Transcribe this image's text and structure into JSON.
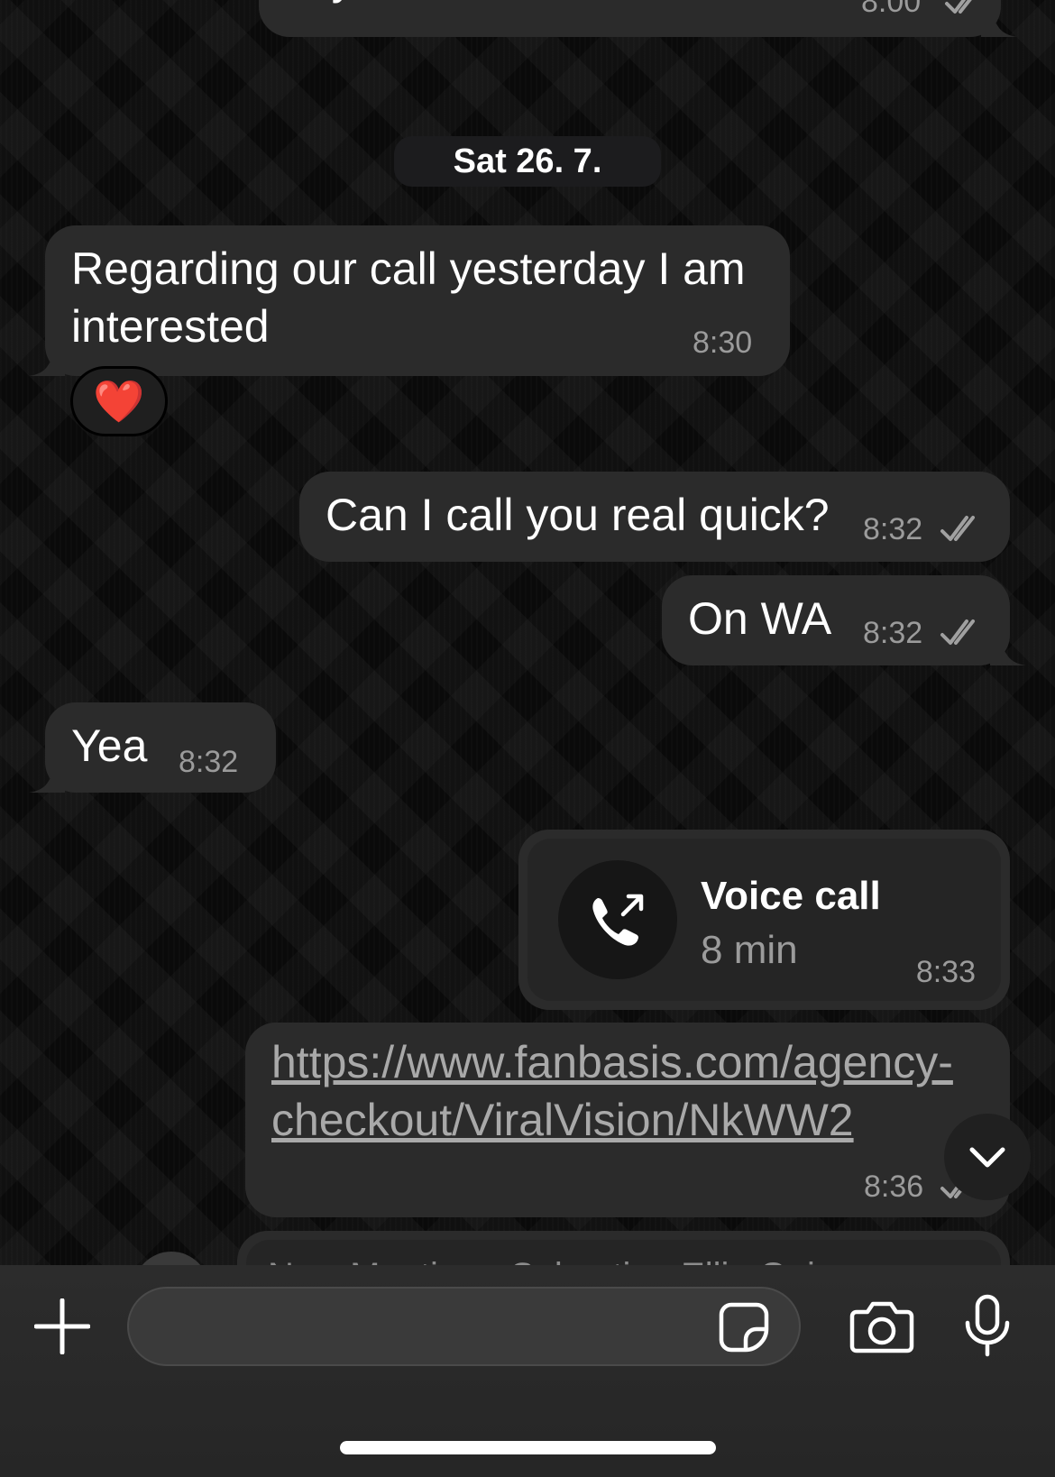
{
  "messages": {
    "top_partial": {
      "text": "in your email",
      "time": "8:00"
    },
    "date_separator": "Sat 26. 7.",
    "m1": {
      "text_line1": "Regarding our call yesterday I am",
      "text_line2": "interested",
      "time": "8:30",
      "reaction": "❤️"
    },
    "m2": {
      "text": "Can I call you real quick?",
      "time": "8:32"
    },
    "m3": {
      "text": "On WA",
      "time": "8:32"
    },
    "m4": {
      "text": "Yea",
      "time": "8:32"
    },
    "call": {
      "title": "Voice call",
      "duration": "8 min",
      "time": "8:33"
    },
    "link": {
      "line1": "https://www.fanbasis.com/agency-",
      "line2": "checkout/ViralVision/NkWW2",
      "time": "8:36"
    },
    "bottom_partial": {
      "text": "New Meeting - Sebastian Ellis-Geiger"
    }
  },
  "composer": {
    "value": "",
    "placeholder": ""
  },
  "icons": {
    "attach": "plus-icon",
    "sticker": "sticker-icon",
    "camera": "camera-icon",
    "mic": "microphone-icon",
    "scroll": "chevron-down-icon",
    "call": "outgoing-call-icon",
    "read": "double-check-icon"
  },
  "colors": {
    "bubble": "#2b2b2b",
    "background": "#0a0a0a",
    "meta": "#9b9b9b",
    "reaction_heart": "#e62020"
  }
}
